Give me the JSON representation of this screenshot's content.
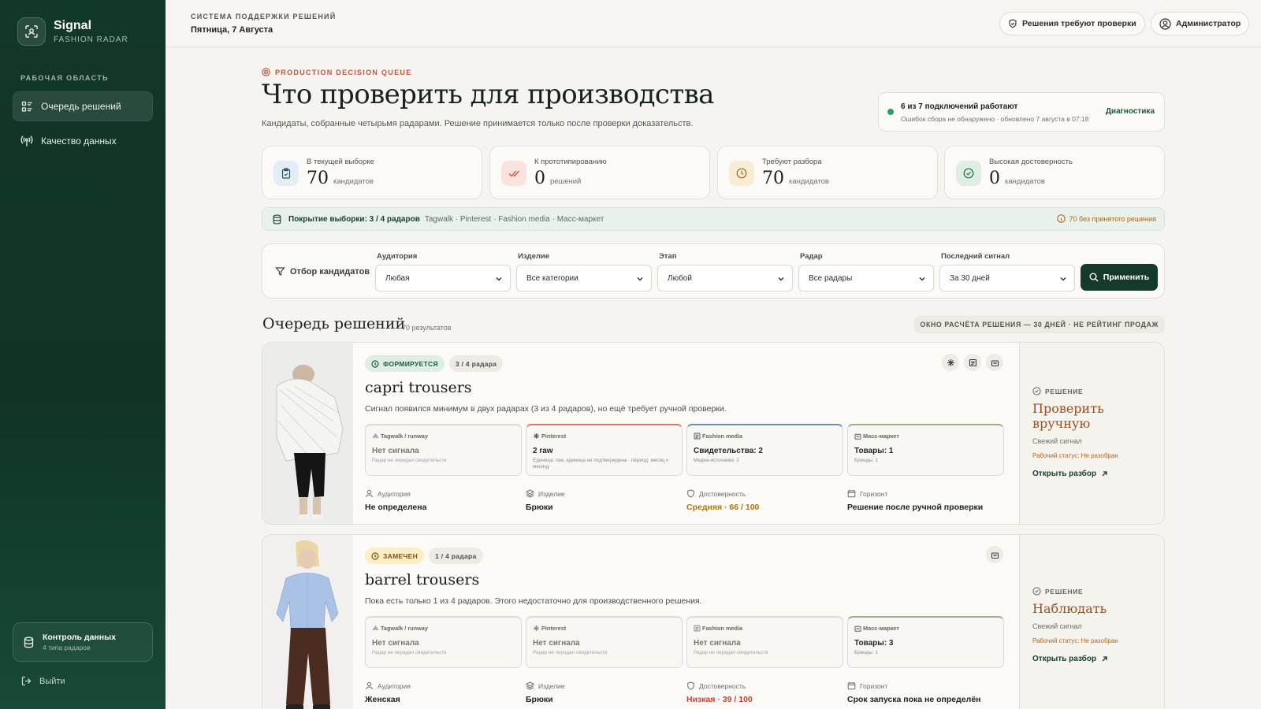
{
  "app": {
    "name": "Signal",
    "subtitle": "FASHION RADAR"
  },
  "sidebar": {
    "section": "РАБОЧАЯ ОБЛАСТЬ",
    "items": [
      {
        "label": "Очередь решений",
        "icon": "list-icon",
        "active": true
      },
      {
        "label": "Качество данных",
        "icon": "broadcast-icon",
        "active": false
      }
    ],
    "data_control": {
      "title": "Контроль данных",
      "sub": "4 типа радаров"
    },
    "logout": "Выйти"
  },
  "topbar": {
    "label": "СИСТЕМА ПОДДЕРЖКИ РЕШЕНИЙ",
    "date": "Пятница, 7 Августа",
    "review_button": "Решения требуют проверки",
    "user_button": "Администратор"
  },
  "page": {
    "eyebrow": "PRODUCTION DECISION QUEUE",
    "title": "Что проверить для производства",
    "subtitle": "Кандидаты, собранные четырьмя радарами. Решение принимается только после проверки доказательств."
  },
  "connections": {
    "status": "6 из 7 подключений работают",
    "sub": "Ошибок сбора не обнаружено · обновлено 7 августа в 07:18",
    "link": "Диагностика",
    "status_color": "#2f9c63"
  },
  "stats": [
    {
      "label": "В текущей выборке",
      "value": "70",
      "unit": "кандидатов",
      "icon": "clipboard-icon",
      "color": "#e3eef4"
    },
    {
      "label": "К прототипированию",
      "value": "0",
      "unit": "решений",
      "icon": "double-check-icon",
      "color": "#fae3de"
    },
    {
      "label": "Требуют разбора",
      "value": "70",
      "unit": "кандидатов",
      "icon": "clock-icon",
      "color": "#f9ecd5"
    },
    {
      "label": "Высокая достоверность",
      "value": "0",
      "unit": "кандидатов",
      "icon": "check-circle-icon",
      "color": "#dfeee4"
    }
  ],
  "coverage": {
    "label": "Покрытие выборки: 3 / 4 радаров",
    "sources": "Tagwalk · Pinterest · Fashion media · Масс-маркет",
    "right": "70 без принятого решения"
  },
  "filters": {
    "title": "Отбор кандидатов",
    "groups": [
      {
        "label": "Аудитория",
        "value": "Любая"
      },
      {
        "label": "Изделие",
        "value": "Все категории"
      },
      {
        "label": "Этап",
        "value": "Любой"
      },
      {
        "label": "Радар",
        "value": "Все радары"
      },
      {
        "label": "Последний сигнал",
        "value": "За 30 дней"
      }
    ],
    "apply": "Применить"
  },
  "queue": {
    "title": "Очередь решений",
    "count": "70 результатов",
    "note": "ОКНО РАСЧЁТА РЕШЕНИЯ — 30 ДНЕЙ · НЕ РЕЙТИНГ ПРОДАЖ"
  },
  "cards": [
    {
      "status": "ФОРМИРУЕТСЯ",
      "radars": "3 / 4 радара",
      "name": "capri trousers",
      "desc": "Сигнал появился минимум в двух радарах (3 из 4 радаров), но ещё требует ручной проверки.",
      "tiles": [
        {
          "source": "Tagwalk / runway",
          "value": "Нет сигнала",
          "sub": "Радар не передал свидетельств",
          "muted": true,
          "accent": "#dcdad3"
        },
        {
          "source": "Pinterest",
          "value": "2 raw",
          "sub": "Единица: raw, единица не подтверждена · период: месяц к месяцу",
          "muted": false,
          "accent": "#d9796a"
        },
        {
          "source": "Fashion media",
          "value": "Свидетельства: 2",
          "sub": "Медиа-источники: 2",
          "muted": false,
          "accent": "#6f8faa"
        },
        {
          "source": "Масс-маркет",
          "value": "Товары: 1",
          "sub": "Бренды: 1",
          "muted": false,
          "accent": "#9fae86"
        }
      ],
      "meta": {
        "audience_label": "Аудитория",
        "audience": "Не определена",
        "product_label": "Изделие",
        "product": "Брюки",
        "confidence_label": "Достоверность",
        "confidence": "Средняя · 66 / 100",
        "horizon_label": "Горизонт",
        "horizon": "Решение после ручной проверки"
      },
      "decision": {
        "label": "РЕШЕНИЕ",
        "value": "Проверить вручную",
        "fresh": "Свежий сигнал",
        "status": "Рабочий статус: Не разобран",
        "open": "Открыть разбор"
      }
    },
    {
      "status": "ЗАМЕЧЕН",
      "radars": "1 / 4 радара",
      "name": "barrel trousers",
      "desc": "Пока есть только 1 из 4 радаров. Этого недостаточно для производственного решения.",
      "tiles": [
        {
          "source": "Tagwalk / runway",
          "value": "Нет сигнала",
          "sub": "Радар не передал свидетельств",
          "muted": true,
          "accent": "#dcdad3"
        },
        {
          "source": "Pinterest",
          "value": "Нет сигнала",
          "sub": "Радар не передал свидетельств",
          "muted": true,
          "accent": "#dcdad3"
        },
        {
          "source": "Fashion media",
          "value": "Нет сигнала",
          "sub": "Радар не передал свидетельств",
          "muted": true,
          "accent": "#dcdad3"
        },
        {
          "source": "Масс-маркет",
          "value": "Товары: 3",
          "sub": "Бренды: 1",
          "muted": false,
          "accent": "#9fae86"
        }
      ],
      "meta": {
        "audience_label": "Аудитория",
        "audience": "Женская",
        "product_label": "Изделие",
        "product": "Брюки",
        "confidence_label": "Достоверность",
        "confidence": "Низкая · 39 / 100",
        "horizon_label": "Горизонт",
        "horizon": "Срок запуска пока не определён"
      },
      "decision": {
        "label": "РЕШЕНИЕ",
        "value": "Наблюдать",
        "fresh": "Свежий сигнал",
        "status": "Рабочий статус: Не разобран",
        "open": "Открыть разбор"
      }
    }
  ]
}
